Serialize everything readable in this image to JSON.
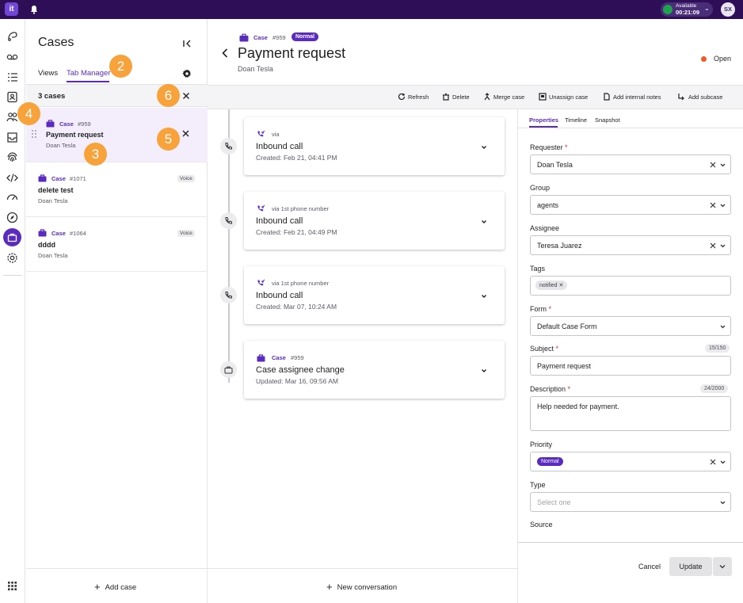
{
  "app": {
    "logo_text": "it",
    "status_label": "Available",
    "status_timer": "00:21:09",
    "user_initials": "SX",
    "brand_color": "#5b2bbf",
    "header_color": "#2d0e57"
  },
  "list": {
    "title": "Cases",
    "tabs": [
      "Views",
      "Tab Manager"
    ],
    "active_tab": "Tab Manager",
    "count_label": "3 cases",
    "items": [
      {
        "type": "Case",
        "number": "#959",
        "title": "Payment request",
        "requester": "Doan Tesla",
        "badge": "",
        "selected": true
      },
      {
        "type": "Case",
        "number": "#1071",
        "title": "delete test",
        "requester": "Doan Tesla",
        "badge": "Voice",
        "selected": false
      },
      {
        "type": "Case",
        "number": "#1064",
        "title": "dddd",
        "requester": "Doan Tesla",
        "badge": "Voice",
        "selected": false
      }
    ],
    "add_case_label": "Add case"
  },
  "callouts": [
    "2",
    "6",
    "4",
    "5",
    "3"
  ],
  "case": {
    "type": "Case",
    "number": "#959",
    "priority": "Normal",
    "title": "Payment request",
    "requester": "Doan Tesla",
    "status": "Open",
    "status_color": "#f05a28"
  },
  "toolbar": {
    "refresh": "Refresh",
    "delete": "Delete",
    "merge": "Merge case",
    "unassign": "Unassign case",
    "add_notes": "Add internal notes",
    "add_subcase": "Add subcase"
  },
  "timeline": [
    {
      "kind": "call",
      "via": "via",
      "title": "Inbound call",
      "date": "Created: Feb 21, 04:41 PM"
    },
    {
      "kind": "call",
      "via": "via 1st phone number",
      "title": "Inbound call",
      "date": "Created: Feb 21, 04:49 PM"
    },
    {
      "kind": "call",
      "via": "via 1st phone number",
      "title": "Inbound call",
      "date": "Created: Mar 07, 10:24 AM"
    },
    {
      "kind": "case",
      "case_type": "Case",
      "case_number": "#959",
      "title": "Case assignee change",
      "date": "Updated: Mar 16, 09:56 AM"
    }
  ],
  "new_conversation_label": "New conversation",
  "properties": {
    "tabs": [
      "Properties",
      "Timeline",
      "Snapshot"
    ],
    "active_tab": "Properties",
    "requester_label": "Requester",
    "requester_value": "Doan Tesla",
    "group_label": "Group",
    "group_value": "agents",
    "assignee_label": "Assignee",
    "assignee_value": "Teresa Juarez",
    "tags_label": "Tags",
    "tag_value": "notified",
    "form_label": "Form",
    "form_value": "Default Case Form",
    "subject_label": "Subject",
    "subject_count": "15/150",
    "subject_value": "Payment request",
    "description_label": "Description",
    "description_count": "24/2000",
    "description_value": "Help needed for payment.",
    "priority_label": "Priority",
    "priority_value": "Normal",
    "type_label": "Type",
    "type_placeholder": "Select one",
    "source_label": "Source",
    "required_mark": "*",
    "cancel_label": "Cancel",
    "update_label": "Update"
  }
}
